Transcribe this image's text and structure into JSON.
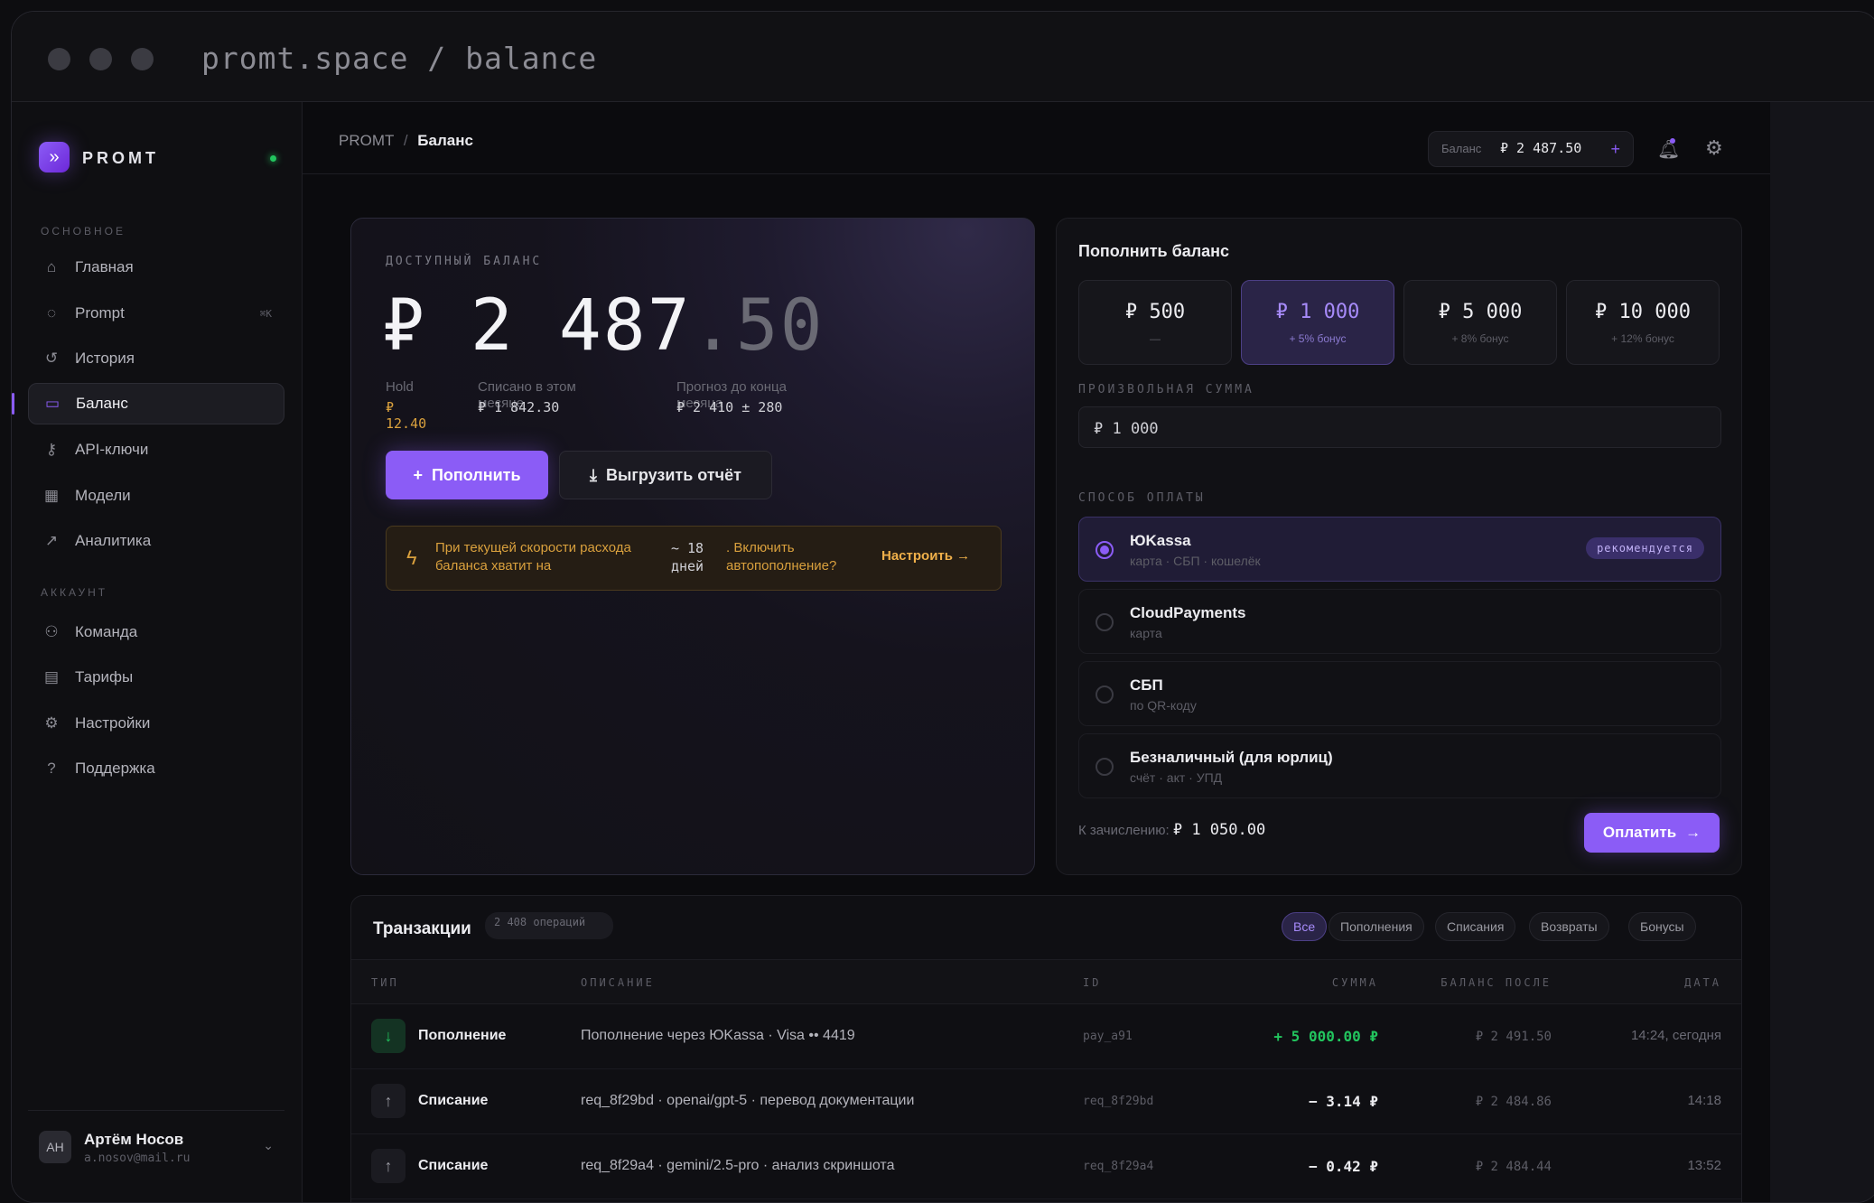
{
  "window": {
    "url": "promt.space / balance"
  },
  "sidebar": {
    "brand": "PROMT",
    "section_main": "ОСНОВНОЕ",
    "items_main": [
      {
        "label": "Главная",
        "icon": "home-icon"
      },
      {
        "label": "Prompt",
        "icon": "chat-icon",
        "kbd": "⌘K"
      },
      {
        "label": "История",
        "icon": "history-icon"
      },
      {
        "label": "Баланс",
        "icon": "wallet-icon",
        "active": true
      },
      {
        "label": "API-ключи",
        "icon": "key-icon"
      },
      {
        "label": "Модели",
        "icon": "grid-icon"
      },
      {
        "label": "Аналитика",
        "icon": "chart-icon"
      }
    ],
    "section_account": "АККАУНТ",
    "items_account": [
      {
        "label": "Команда",
        "icon": "team-icon"
      },
      {
        "label": "Тарифы",
        "icon": "document-icon"
      },
      {
        "label": "Настройки",
        "icon": "gear-icon"
      },
      {
        "label": "Поддержка",
        "icon": "help-icon"
      }
    ],
    "user": {
      "initials": "АН",
      "name": "Артём Носов",
      "email": "a.nosov@mail.ru"
    }
  },
  "topbar": {
    "breadcrumb_root": "PROMT",
    "breadcrumb_sep": "/",
    "breadcrumb_current": "Баланс",
    "balance_label": "Баланс",
    "balance_value": "₽ 2 487.50",
    "balance_plus": "+"
  },
  "balance_card": {
    "label": "ДОСТУПНЫЙ БАЛАНС",
    "amount_int": "₽ 2 487",
    "amount_dec": ".50",
    "hold_label": "Hold",
    "hold_value": "₽ 12.40",
    "spent_label": "Списано в этом месяце",
    "spent_value": "₽ 1 842.30",
    "forecast_label": "Прогноз до конца месяца",
    "forecast_value": "₽ 2 410 ± 280",
    "topup_button": "Пополнить",
    "export_button": "Выгрузить отчёт",
    "warning_text": "При текущей скорости расхода баланса хватит на",
    "warning_days": "~ 18 дней",
    "warning_question": ". Включить автопополнение?",
    "warning_link": "Настроить →"
  },
  "topup": {
    "title": "Пополнить баланс",
    "amounts": [
      {
        "amount": "₽ 500",
        "bonus": "—"
      },
      {
        "amount": "₽ 1 000",
        "bonus": "+ 5% бонус",
        "selected": true
      },
      {
        "amount": "₽ 5 000",
        "bonus": "+ 8% бонус"
      },
      {
        "amount": "₽ 10 000",
        "bonus": "+ 12% бонус"
      }
    ],
    "custom_label": "ПРОИЗВОЛЬНАЯ СУММА",
    "custom_value": "₽ 1 000",
    "method_label": "СПОСОБ ОПЛАТЫ",
    "methods": [
      {
        "name": "ЮKassa",
        "sub": "карта · СБП · кошелёк",
        "badge": "рекомендуется",
        "selected": true
      },
      {
        "name": "CloudPayments",
        "sub": "карта"
      },
      {
        "name": "СБП",
        "sub": "по QR-коду"
      },
      {
        "name": "Безналичный (для юрлиц)",
        "sub": "счёт · акт · УПД"
      }
    ],
    "credit_label": "К зачислению:",
    "credit_value": "₽ 1 050.00",
    "pay_button": "Оплатить"
  },
  "transactions": {
    "title": "Транзакции",
    "count": "2 408 операций",
    "filters": [
      "Все",
      "Пополнения",
      "Списания",
      "Возвраты",
      "Бонусы"
    ],
    "columns": [
      "ТИП",
      "ОПИСАНИЕ",
      "ID",
      "СУММА",
      "БАЛАНС ПОСЛЕ",
      "ДАТА"
    ],
    "rows": [
      {
        "dir": "in",
        "type": "Пополнение",
        "desc": "Пополнение через ЮKassa · Visa •• 4419",
        "id": "pay_a91",
        "sum": "+ 5 000.00 ₽",
        "after": "₽ 2 491.50",
        "date": "14:24, сегодня"
      },
      {
        "dir": "out",
        "type": "Списание",
        "desc": "req_8f29bd · openai/gpt-5 · перевод документации",
        "id": "req_8f29bd",
        "sum": "− 3.14 ₽",
        "after": "₽ 2 484.86",
        "date": "14:18"
      },
      {
        "dir": "out",
        "type": "Списание",
        "desc": "req_8f29a4 · gemini/2.5-pro · анализ скриншота",
        "id": "req_8f29a4",
        "sum": "− 0.42 ₽",
        "after": "₽ 2 484.44",
        "date": "13:52"
      }
    ]
  },
  "colors": {
    "accent": "#8b5cf6",
    "positive": "#22c55e",
    "warning": "#d9a03d"
  }
}
